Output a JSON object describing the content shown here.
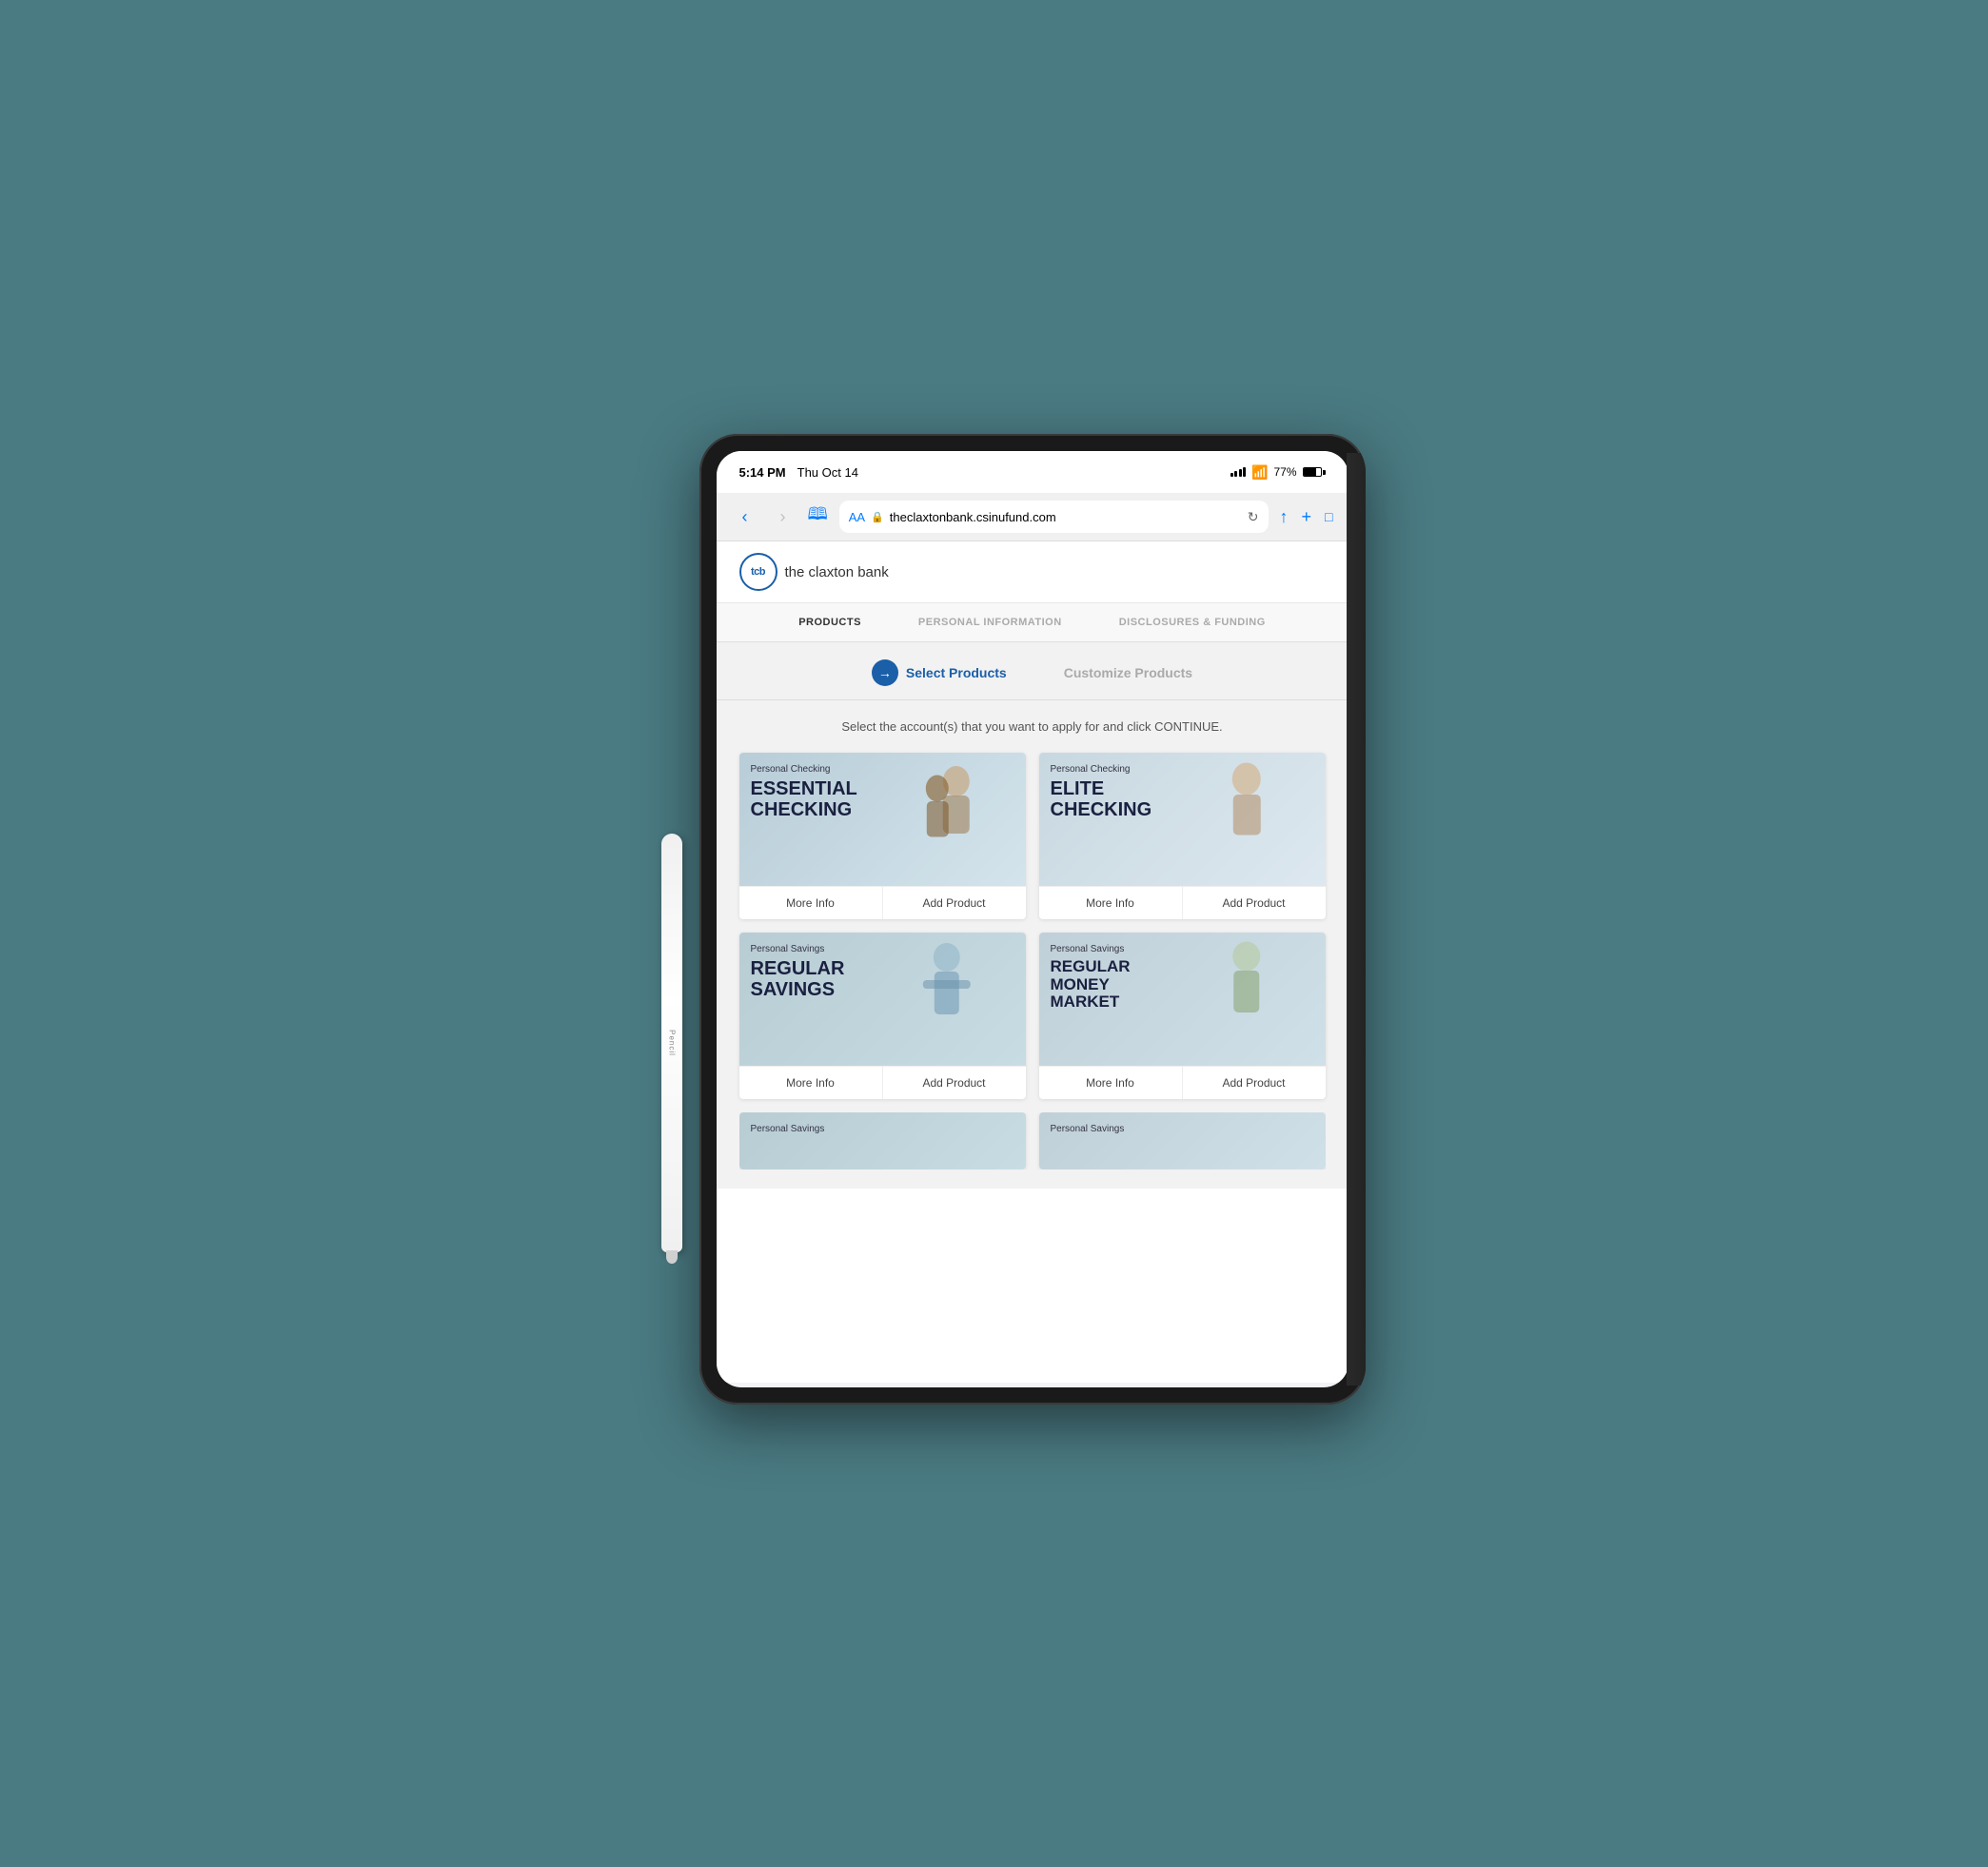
{
  "scene": {
    "background_color": "#4a7a82"
  },
  "status_bar": {
    "time": "5:14 PM",
    "date": "Thu Oct 14",
    "battery": "77%",
    "signal": "signal"
  },
  "browser": {
    "back_button": "‹",
    "forward_button": "›",
    "aa_label": "AA",
    "lock_icon": "🔒",
    "url": "theclaxtonbank.csinufund.com",
    "reload_icon": "↻",
    "share_icon": "↑",
    "add_icon": "+",
    "tabs_icon": "⧉"
  },
  "bank": {
    "logo_text": "tcb",
    "name": "the claxton bank"
  },
  "steps": {
    "items": [
      {
        "label": "PRODUCTS",
        "active": true
      },
      {
        "label": "PERSONAL INFORMATION",
        "active": false
      },
      {
        "label": "DISCLOSURES & FUNDING",
        "active": false
      }
    ]
  },
  "wizard": {
    "steps": [
      {
        "label": "Select Products",
        "active": true,
        "icon": "→"
      },
      {
        "label": "Customize Products",
        "active": false
      }
    ]
  },
  "content": {
    "instructions": "Select the account(s) that you want to apply for and click CONTINUE."
  },
  "products": [
    {
      "id": "essential-checking",
      "category": "Personal Checking",
      "name": "ESSENTIAL\nCHECKING",
      "name_display": "ESSENTIAL CHECKING",
      "color_class": "card-essential",
      "more_info_label": "More Info",
      "add_product_label": "Add Product"
    },
    {
      "id": "elite-checking",
      "category": "Personal Checking",
      "name": "ELITE\nCHECKING",
      "name_display": "ELITE CHECKING",
      "color_class": "card-elite",
      "more_info_label": "More Info",
      "add_product_label": "Add Product"
    },
    {
      "id": "regular-savings",
      "category": "Personal Savings",
      "name": "REGULAR\nSAVINGS",
      "name_display": "REGULAR SAVINGS",
      "color_class": "card-savings",
      "more_info_label": "More Info",
      "add_product_label": "Add Product"
    },
    {
      "id": "regular-money-market",
      "category": "Personal Savings",
      "name": "REGULAR\nMONEY\nMARKET",
      "name_display": "REGULAR MONEY MARKET",
      "color_class": "card-money-market",
      "more_info_label": "More Info",
      "add_product_label": "Add Product"
    }
  ],
  "partial_products": [
    {
      "id": "personal-savings-5",
      "category": "Personal Savings",
      "color_class": "card-savings"
    },
    {
      "id": "personal-savings-6",
      "category": "Personal Savings",
      "color_class": "card-money-market"
    }
  ]
}
